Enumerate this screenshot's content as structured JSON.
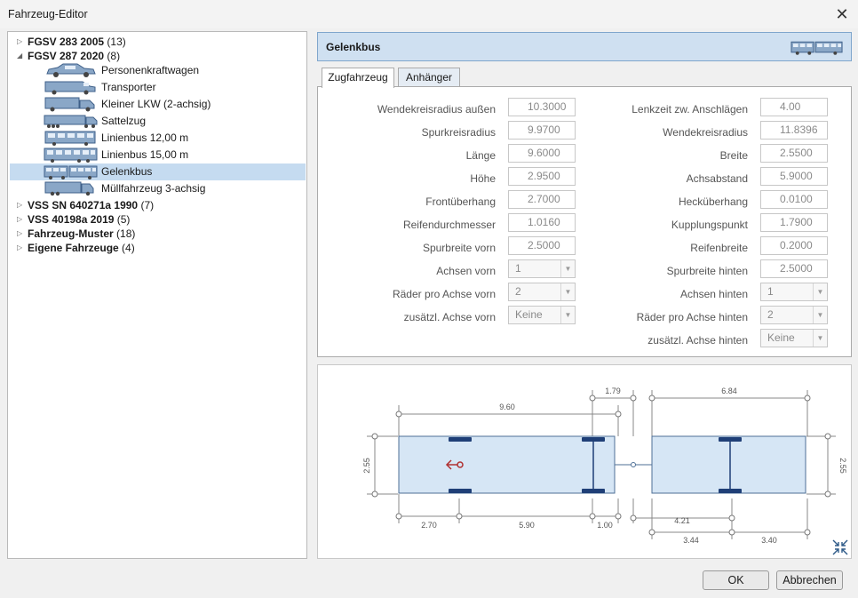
{
  "window": {
    "title": "Fahrzeug-Editor"
  },
  "tree": {
    "groups": [
      {
        "name": "FGSV 283 2005",
        "count": "(13)",
        "expanded": false
      },
      {
        "name": "FGSV 287 2020",
        "count": "(8)",
        "expanded": true
      },
      {
        "name": "VSS SN 640271a 1990",
        "count": "(7)",
        "expanded": false
      },
      {
        "name": "VSS 40198a 2019",
        "count": "(5)",
        "expanded": false
      },
      {
        "name": "Fahrzeug-Muster",
        "count": "(18)",
        "expanded": false
      },
      {
        "name": "Eigene Fahrzeuge",
        "count": "(4)",
        "expanded": false
      }
    ],
    "children": [
      {
        "label": "Personenkraftwagen",
        "icon": "car-icon"
      },
      {
        "label": "Transporter",
        "icon": "van-icon"
      },
      {
        "label": "Kleiner LKW (2-achsig)",
        "icon": "small-truck-icon"
      },
      {
        "label": "Sattelzug",
        "icon": "semi-truck-icon"
      },
      {
        "label": "Linienbus 12,00 m",
        "icon": "bus-icon"
      },
      {
        "label": "Linienbus 15,00 m",
        "icon": "long-bus-icon"
      },
      {
        "label": "Gelenkbus",
        "icon": "articulated-bus-icon"
      },
      {
        "label": "Müllfahrzeug 3-achsig",
        "icon": "garbage-truck-icon"
      }
    ],
    "selected": "Gelenkbus"
  },
  "header": {
    "title": "Gelenkbus",
    "icon": "articulated-bus-icon"
  },
  "tabs": [
    {
      "label": "Zugfahrzeug"
    },
    {
      "label": "Anhänger"
    }
  ],
  "form": {
    "left": [
      {
        "label": "Wendekreisradius außen",
        "value": "10.3000"
      },
      {
        "label": "Spurkreisradius",
        "value": "9.9700"
      },
      {
        "label": "Länge",
        "value": "9.6000"
      },
      {
        "label": "Höhe",
        "value": "2.9500"
      },
      {
        "label": "Frontüberhang",
        "value": "2.7000"
      },
      {
        "label": "Reifendurchmesser",
        "value": "1.0160"
      },
      {
        "label": "Spurbreite vorn",
        "value": "2.5000"
      },
      {
        "label": "Achsen vorn",
        "value": "1"
      },
      {
        "label": "Räder pro Achse vorn",
        "value": "2"
      },
      {
        "label": "zusätzl. Achse vorn",
        "value": "Keine"
      }
    ],
    "right": [
      {
        "label": "Lenkzeit zw. Anschlägen",
        "value": "4.00"
      },
      {
        "label": "Wendekreisradius",
        "value": "11.8396"
      },
      {
        "label": "Breite",
        "value": "2.5500"
      },
      {
        "label": "Achsabstand",
        "value": "5.9000"
      },
      {
        "label": "Hecküberhang",
        "value": "0.0100"
      },
      {
        "label": "Kupplungspunkt",
        "value": "1.7900"
      },
      {
        "label": "Reifenbreite",
        "value": "0.2000"
      },
      {
        "label": "Spurbreite hinten",
        "value": "2.5000"
      },
      {
        "label": "Achsen hinten",
        "value": "1"
      },
      {
        "label": "Räder pro Achse hinten",
        "value": "2"
      },
      {
        "label": "zusätzl. Achse hinten",
        "value": "Keine"
      }
    ]
  },
  "diagram": {
    "dims": {
      "length": "9.60",
      "coupling": "1.79",
      "trailer_length": "6.84",
      "width_left": "2.55",
      "width_right": "2.55",
      "front_overhang": "2.70",
      "wheelbase": "5.90",
      "rear": "1.00",
      "trailer_a": "4.21",
      "trailer_b": "3.44",
      "trailer_c": "3.40"
    },
    "collapse_icon": "collapse-icon"
  },
  "buttons": {
    "ok": "OK",
    "cancel": "Abbrechen"
  }
}
